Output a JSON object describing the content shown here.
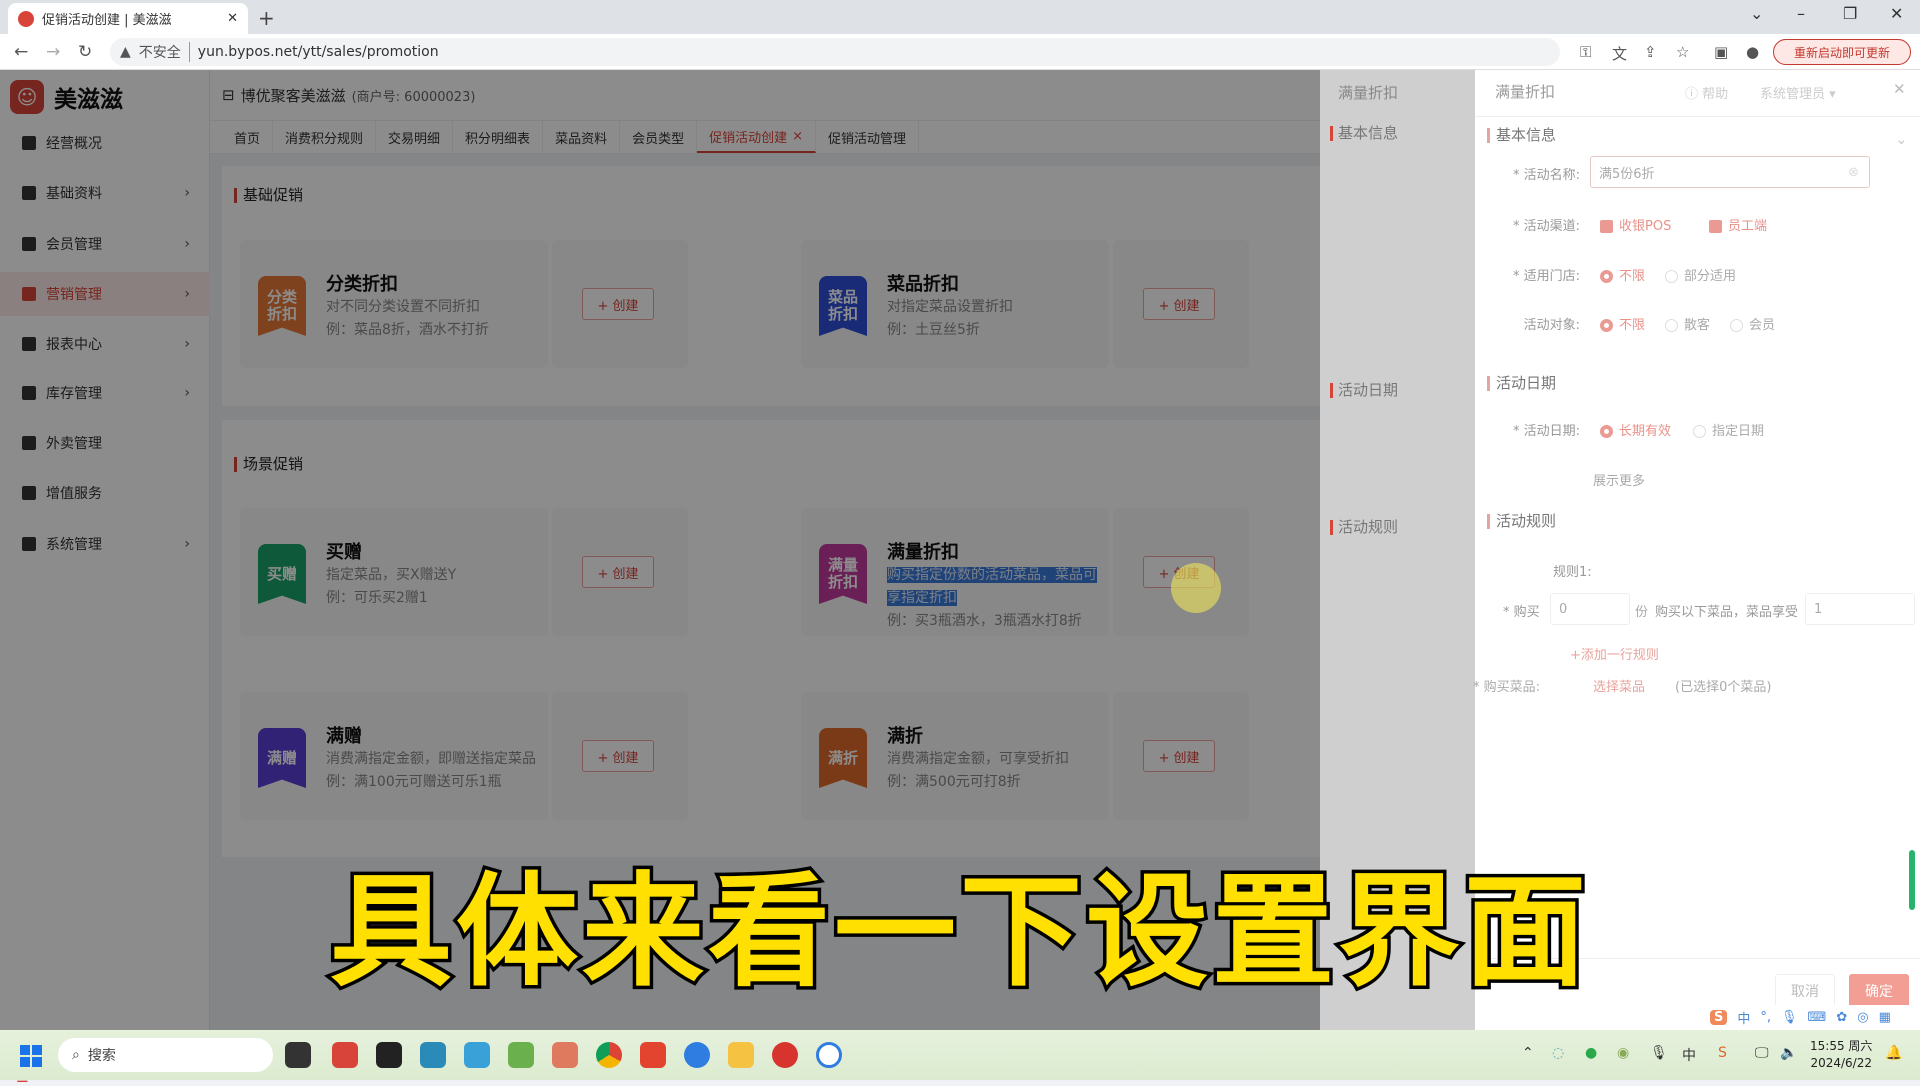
{
  "browser": {
    "tab_title": "促销活动创建 | 美滋滋",
    "security_label": "不安全",
    "url": "yun.bypos.net/ytt/sales/promotion",
    "update_button": "重新启动即可更新"
  },
  "app": {
    "logo_name": "美滋滋",
    "store_name": "博优聚客美滋滋",
    "merchant_no": "(商户号: 60000023)",
    "brand_color": "#d9443a"
  },
  "sidebar": {
    "items": [
      {
        "label": "经营概况",
        "icon": "chart-icon",
        "has_children": false
      },
      {
        "label": "基础资料",
        "icon": "database-icon",
        "has_children": true
      },
      {
        "label": "会员管理",
        "icon": "diamond-icon",
        "has_children": true
      },
      {
        "label": "营销管理",
        "icon": "marketing-icon",
        "has_children": true,
        "active": true
      },
      {
        "label": "报表中心",
        "icon": "report-icon",
        "has_children": true
      },
      {
        "label": "库存管理",
        "icon": "inventory-icon",
        "has_children": true
      },
      {
        "label": "外卖管理",
        "icon": "delivery-icon",
        "has_children": false
      },
      {
        "label": "增值服务",
        "icon": "apps-icon",
        "has_children": false
      },
      {
        "label": "系统管理",
        "icon": "gear-icon",
        "has_children": true
      }
    ]
  },
  "page_tabs": [
    "首页",
    "消费积分规则",
    "交易明细",
    "积分明细表",
    "菜品资料",
    "会员类型",
    "促销活动创建",
    "促销活动管理"
  ],
  "active_tab": "促销活动创建",
  "main": {
    "basic_section": "基础促销",
    "scene_section": "场景促销",
    "create_label": "+ 创建",
    "basic_cards": [
      {
        "badge": "分类折扣",
        "color": "#e8793a",
        "name": "分类折扣",
        "desc": "对不同分类设置不同折扣",
        "example": "例：菜品8折，酒水不打折"
      },
      {
        "badge": "菜品折扣",
        "color": "#2e4fd8",
        "name": "菜品折扣",
        "desc": "对指定菜品设置折扣",
        "example": "例：土豆丝5折"
      }
    ],
    "scene_cards": [
      {
        "badge": "买赠",
        "color": "#1aa36b",
        "name": "买赠",
        "desc": "指定菜品，买X赠送Y",
        "example": "例：可乐买2赠1"
      },
      {
        "badge": "满量折扣",
        "color": "#c2399f",
        "name": "满量折扣",
        "desc": "购买指定份数的活动菜品，菜品可享指定折扣",
        "example": "例：买3瓶酒水，3瓶酒水打8折",
        "selected": true
      },
      {
        "badge": "满赠",
        "color": "#5a3ed6",
        "name": "满赠",
        "desc": "消费满指定金额，即赠送指定菜品",
        "example": "例：满100元可赠送可乐1瓶"
      },
      {
        "badge": "满折",
        "color": "#e06a2a",
        "name": "满折",
        "desc": "消费满指定金额，可享受折扣",
        "example": "例：满500元可打8折"
      }
    ]
  },
  "drawer": {
    "title": "满量折扣",
    "help": "帮助",
    "user": "系统管理员",
    "sections": {
      "basic": "基本信息",
      "date": "活动日期",
      "rules": "活动规则"
    },
    "fields": {
      "name_label": "* 活动名称:",
      "name_value": "满5份6折",
      "channel_label": "* 活动渠道:",
      "channels": [
        {
          "label": "收银POS",
          "checked": true
        },
        {
          "label": "员工端",
          "checked": true
        }
      ],
      "store_label": "* 适用门店:",
      "store_options": [
        {
          "label": "不限",
          "selected": true
        },
        {
          "label": "部分适用",
          "selected": false
        }
      ],
      "target_label": "活动对象:",
      "target_options": [
        {
          "label": "不限",
          "selected": true
        },
        {
          "label": "散客",
          "selected": false
        },
        {
          "label": "会员",
          "selected": false
        }
      ],
      "date_label": "* 活动日期:",
      "date_options": [
        {
          "label": "长期有效",
          "selected": true
        },
        {
          "label": "指定日期",
          "selected": false
        }
      ],
      "show_more": "展示更多",
      "rule_label": "规则1:",
      "buy_label": "* 购买",
      "buy_qty": "0",
      "unit": "份",
      "rule_text": "购买以下菜品，菜品享受",
      "discount_value": "1",
      "add_rule": "+添加一行规则",
      "dishes_label": "* 购买菜品:",
      "select_dishes": "选择菜品",
      "selected_count": "(已选择0个菜品)"
    },
    "cancel": "取消",
    "confirm": "确定"
  },
  "caption": "具体来看一下设置界面",
  "ime": {
    "mode": "中"
  },
  "taskbar": {
    "search": "搜索",
    "time": "15:55 周六",
    "date": "2024/6/22"
  }
}
